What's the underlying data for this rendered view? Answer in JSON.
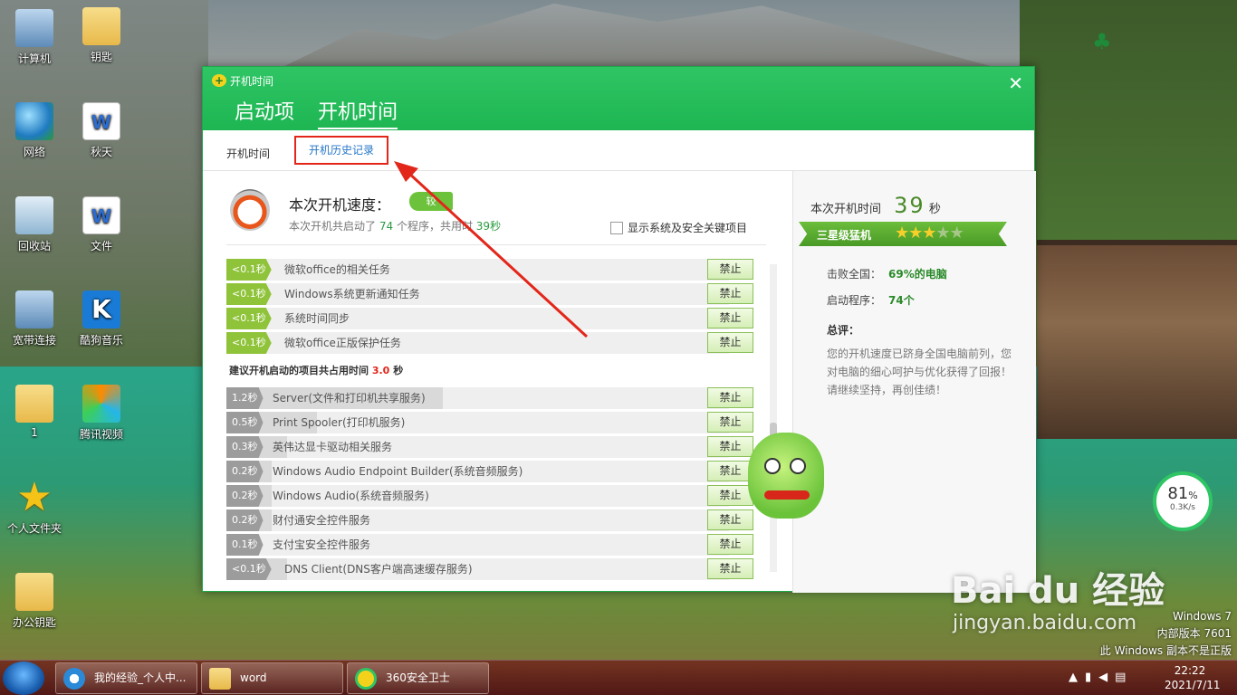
{
  "desktop": {
    "icons": [
      {
        "label": "计算机",
        "kind": "comp"
      },
      {
        "label": "钥匙",
        "kind": "folder"
      },
      {
        "label": "网络",
        "kind": "globe"
      },
      {
        "label": "秋天",
        "kind": "doc",
        "glyph": "W"
      },
      {
        "label": "回收站",
        "kind": "bin"
      },
      {
        "label": "文件",
        "kind": "doc",
        "glyph": "W"
      },
      {
        "label": "宽带连接",
        "kind": "net"
      },
      {
        "label": "酷狗音乐",
        "kind": "kugou",
        "glyph": "K"
      },
      {
        "label": "1",
        "kind": "folder"
      },
      {
        "label": "腾讯视频",
        "kind": "txv"
      },
      {
        "label": "个人文件夹",
        "kind": "star",
        "glyph": "★"
      },
      {
        "label": "办公钥匙",
        "kind": "folder"
      }
    ],
    "watermark": "Bai du 经验",
    "watermark_url": "jingyan.baidu.com",
    "os_info": [
      "Windows 7",
      "内部版本 7601",
      "此 Windows 副本不是正版"
    ],
    "speed_widget": {
      "percent": "81",
      "percent_unit": "%",
      "rate": "0.3K/s"
    }
  },
  "window": {
    "title": "开机时间",
    "close_glyph": "✕",
    "main_tabs": [
      "启动项",
      "开机时间"
    ],
    "sub_tabs": [
      "开机时间",
      "开机历史记录"
    ],
    "speed_title": "本次开机速度：",
    "speed_badge": "较",
    "speed_summary_prefix": "本次开机共启动了",
    "program_count": "74",
    "speed_summary_mid": "个程序，共用时",
    "speed_summary_time": "39秒",
    "show_system_label": "显示系统及安全关键项目",
    "block_label": "禁止",
    "quick_items": [
      {
        "time": "<0.1秒",
        "name": "微软office的相关任务"
      },
      {
        "time": "<0.1秒",
        "name": "Windows系统更新通知任务"
      },
      {
        "time": "<0.1秒",
        "name": "系统时间同步"
      },
      {
        "time": "<0.1秒",
        "name": "微软office正版保护任务"
      }
    ],
    "suggest_prefix": "建议开机启动的项目共占用时间",
    "suggest_time": "3.0",
    "suggest_unit": "秒",
    "suggest_items": [
      {
        "time": "1.2秒",
        "name": "Server(文件和打印机共享服务)",
        "share": 0.43
      },
      {
        "time": "0.5秒",
        "name": "Print Spooler(打印机服务)",
        "share": 0.18
      },
      {
        "time": "0.3秒",
        "name": "英伟达显卡驱动相关服务",
        "share": 0.12
      },
      {
        "time": "0.2秒",
        "name": "Windows Audio Endpoint Builder(系统音频服务)",
        "share": 0.09
      },
      {
        "time": "0.2秒",
        "name": "Windows Audio(系统音频服务)",
        "share": 0.09
      },
      {
        "time": "0.2秒",
        "name": "财付通安全控件服务",
        "share": 0.09
      },
      {
        "time": "0.1秒",
        "name": "支付宝安全控件服务",
        "share": 0.05
      },
      {
        "time": "<0.1秒",
        "name": "DNS Client(DNS客户端高速缓存服务)",
        "share": 0.12
      }
    ],
    "right": {
      "boot_time_label": "本次开机时间",
      "boot_time_value": "39",
      "boot_time_unit": "秒",
      "level": "三星级猛机",
      "stars_on": 3,
      "stars_total": 5,
      "beat_label": "击败全国：",
      "beat_value": "69%的电脑",
      "programs_label": "启动程序：",
      "programs_value": "74个",
      "comment_title": "总评：",
      "comment_text": "您的开机速度已跻身全国电脑前列，您对电脑的细心呵护与优化获得了回报！请继续坚持，再创佳绩！"
    }
  },
  "taskbar": {
    "items": [
      {
        "label": "我的经验_个人中..."
      },
      {
        "label": "word"
      },
      {
        "label": "360安全卫士"
      }
    ],
    "time": "22:22",
    "date": "2021/7/11"
  },
  "colors": {
    "accent": "#1eb553",
    "highlight": "#e3261a"
  }
}
